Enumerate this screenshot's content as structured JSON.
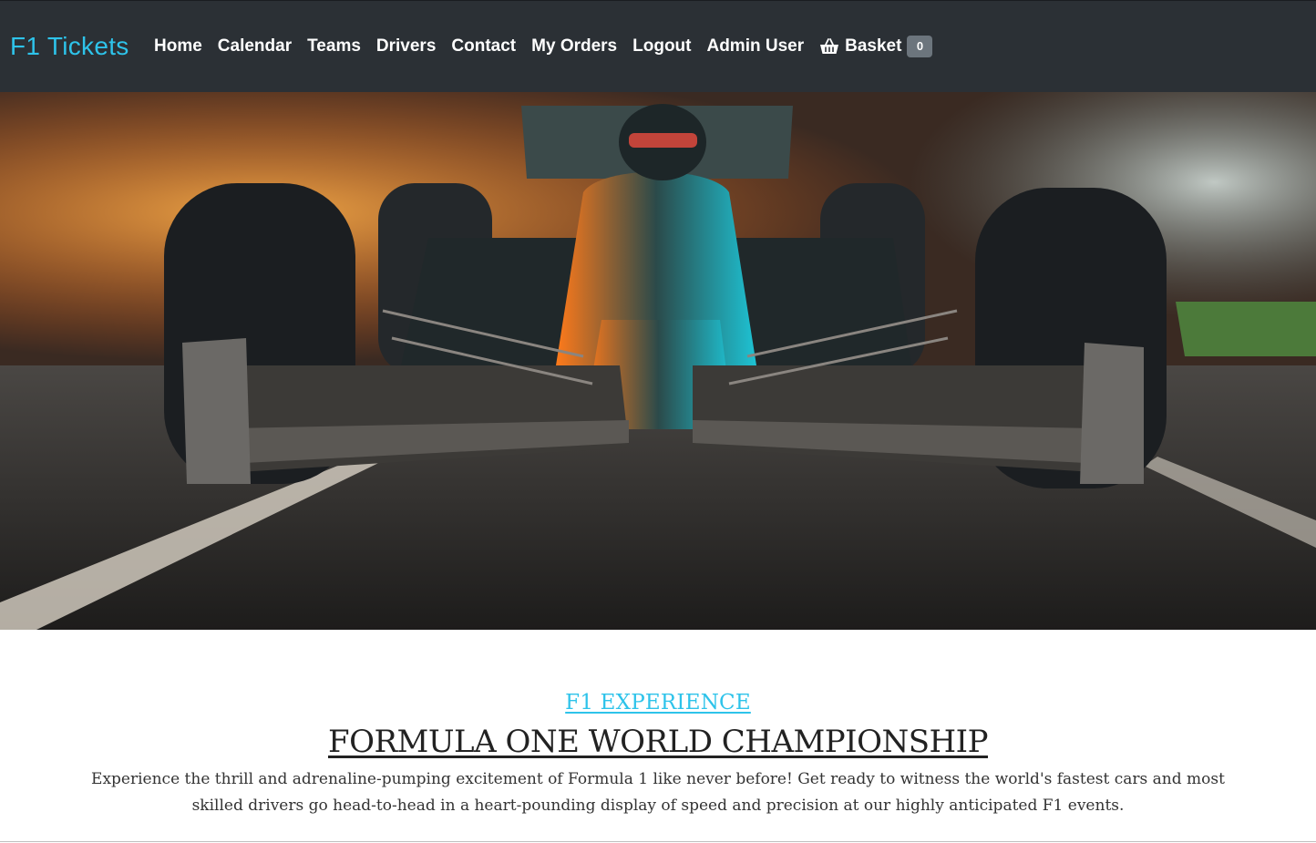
{
  "brand": "F1 Tickets",
  "nav": {
    "home": "Home",
    "calendar": "Calendar",
    "teams": "Teams",
    "drivers": "Drivers",
    "contact": "Contact",
    "my_orders": "My Orders",
    "logout": "Logout",
    "user": "Admin User",
    "basket_label": "Basket",
    "basket_count": "0"
  },
  "hero": {
    "image": "formula-one-race-car-photo",
    "icon": "basket-icon"
  },
  "intro": {
    "eyebrow": "F1 EXPERIENCE",
    "headline": "FORMULA ONE WORLD CHAMPIONSHIP",
    "text": "Experience the thrill and adrenaline-pumping excitement of Formula 1 like never before! Get ready to witness the world's fastest cars and most skilled drivers go head-to-head in a heart-pounding display of speed and precision at our highly anticipated F1 events."
  },
  "colors": {
    "navbar": "#2b3035",
    "accent": "#2ec3ea",
    "badge": "#6c757d"
  }
}
